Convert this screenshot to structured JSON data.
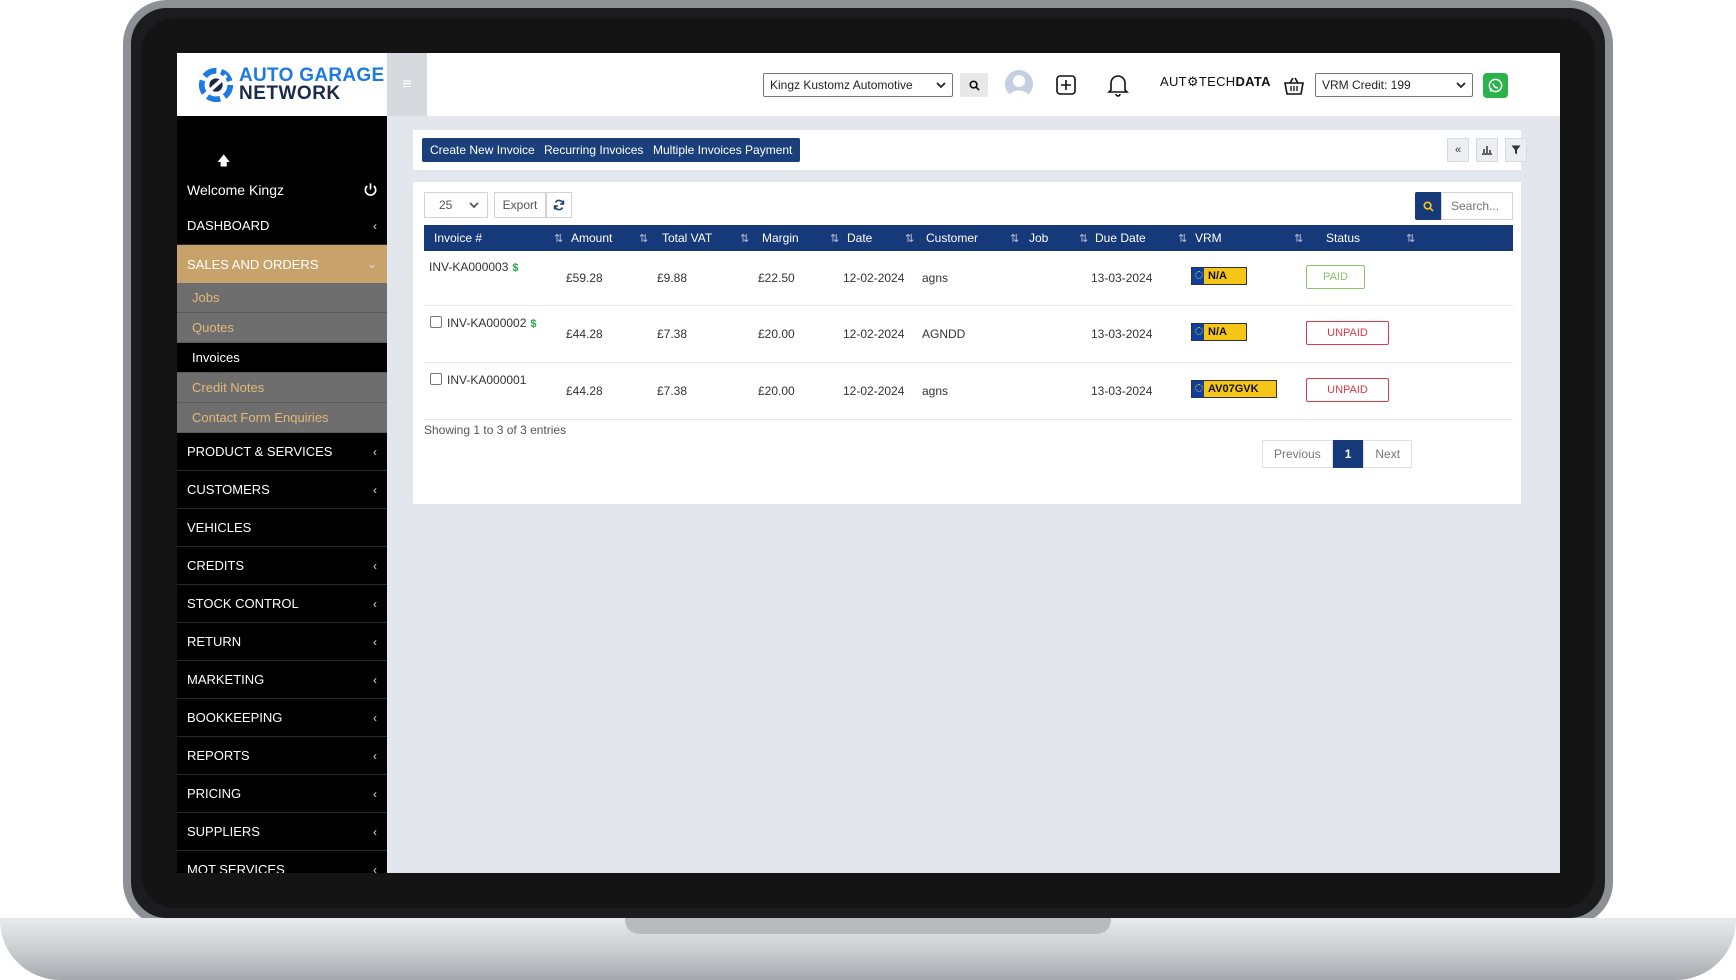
{
  "app": {
    "logo_line1": "AUTO GARAGE",
    "logo_line2": "NETWORK",
    "brand_color": "#1f7ae0"
  },
  "topbar": {
    "garage_select_value": "Kingz Kustomz Automotive",
    "autotech_prefix": "AUT",
    "autotech_mid": "TECH",
    "autotech_bold": "DATA",
    "vrm_select_value": "VRM Credit: 199"
  },
  "sidebar": {
    "welcome": "Welcome Kingz",
    "items": [
      {
        "label": "DASHBOARD",
        "chevron": "‹"
      },
      {
        "label": "SALES AND ORDERS",
        "chevron": "⌄",
        "active": true
      },
      {
        "label": "PRODUCT & SERVICES",
        "chevron": "‹"
      },
      {
        "label": "CUSTOMERS",
        "chevron": "‹"
      },
      {
        "label": "VEHICLES",
        "chevron": ""
      },
      {
        "label": "CREDITS",
        "chevron": "‹"
      },
      {
        "label": "STOCK CONTROL",
        "chevron": "‹"
      },
      {
        "label": "RETURN",
        "chevron": "‹"
      },
      {
        "label": "MARKETING",
        "chevron": "‹"
      },
      {
        "label": "BOOKKEEPING",
        "chevron": "‹"
      },
      {
        "label": "REPORTS",
        "chevron": "‹"
      },
      {
        "label": "PRICING",
        "chevron": "‹"
      },
      {
        "label": "SUPPLIERS",
        "chevron": "‹"
      },
      {
        "label": "MOT SERVICES",
        "chevron": "‹"
      }
    ],
    "sub_items": [
      "Jobs",
      "Quotes",
      "Invoices",
      "Credit Notes",
      "Contact Form Enquiries"
    ],
    "active_color": "#c7a26a"
  },
  "toolbar": {
    "create_label": "Create New Invoice",
    "recurring_label": "Recurring Invoices",
    "multi_label": "Multiple Invoices Payment"
  },
  "table": {
    "page_length": "25",
    "export_label": "Export",
    "search_placeholder": "Search...",
    "columns": [
      "Invoice #",
      "Amount",
      "Total VAT",
      "Margin",
      "Date",
      "Customer",
      "Job",
      "Due Date",
      "VRM",
      "Status"
    ],
    "rows": [
      {
        "invoice": "INV-KA000003",
        "amount": "£59.28",
        "vat": "£9.88",
        "margin": "£22.50",
        "date": "12-02-2024",
        "customer": "agns",
        "job": "",
        "due": "13-03-2024",
        "vrm": "N/A",
        "status": "PAID",
        "dollar": "$"
      },
      {
        "invoice": "INV-KA000002",
        "amount": "£44.28",
        "vat": "£7.38",
        "margin": "£20.00",
        "date": "12-02-2024",
        "customer": "AGNDD",
        "job": "",
        "due": "13-03-2024",
        "vrm": "N/A",
        "status": "UNPAID",
        "dollar": "$"
      },
      {
        "invoice": "INV-KA000001",
        "amount": "£44.28",
        "vat": "£7.38",
        "margin": "£20.00",
        "date": "12-02-2024",
        "customer": "agns",
        "job": "",
        "due": "13-03-2024",
        "vrm": "AV07GVK",
        "status": "UNPAID",
        "dollar": ""
      }
    ],
    "showing": "Showing 1 to 3 of 3 entries",
    "pager": {
      "previous": "Previous",
      "current": "1",
      "next": "Next"
    },
    "header_color": "#16397a",
    "paid_color": "#8cc46a",
    "unpaid_color": "#e0394a"
  }
}
